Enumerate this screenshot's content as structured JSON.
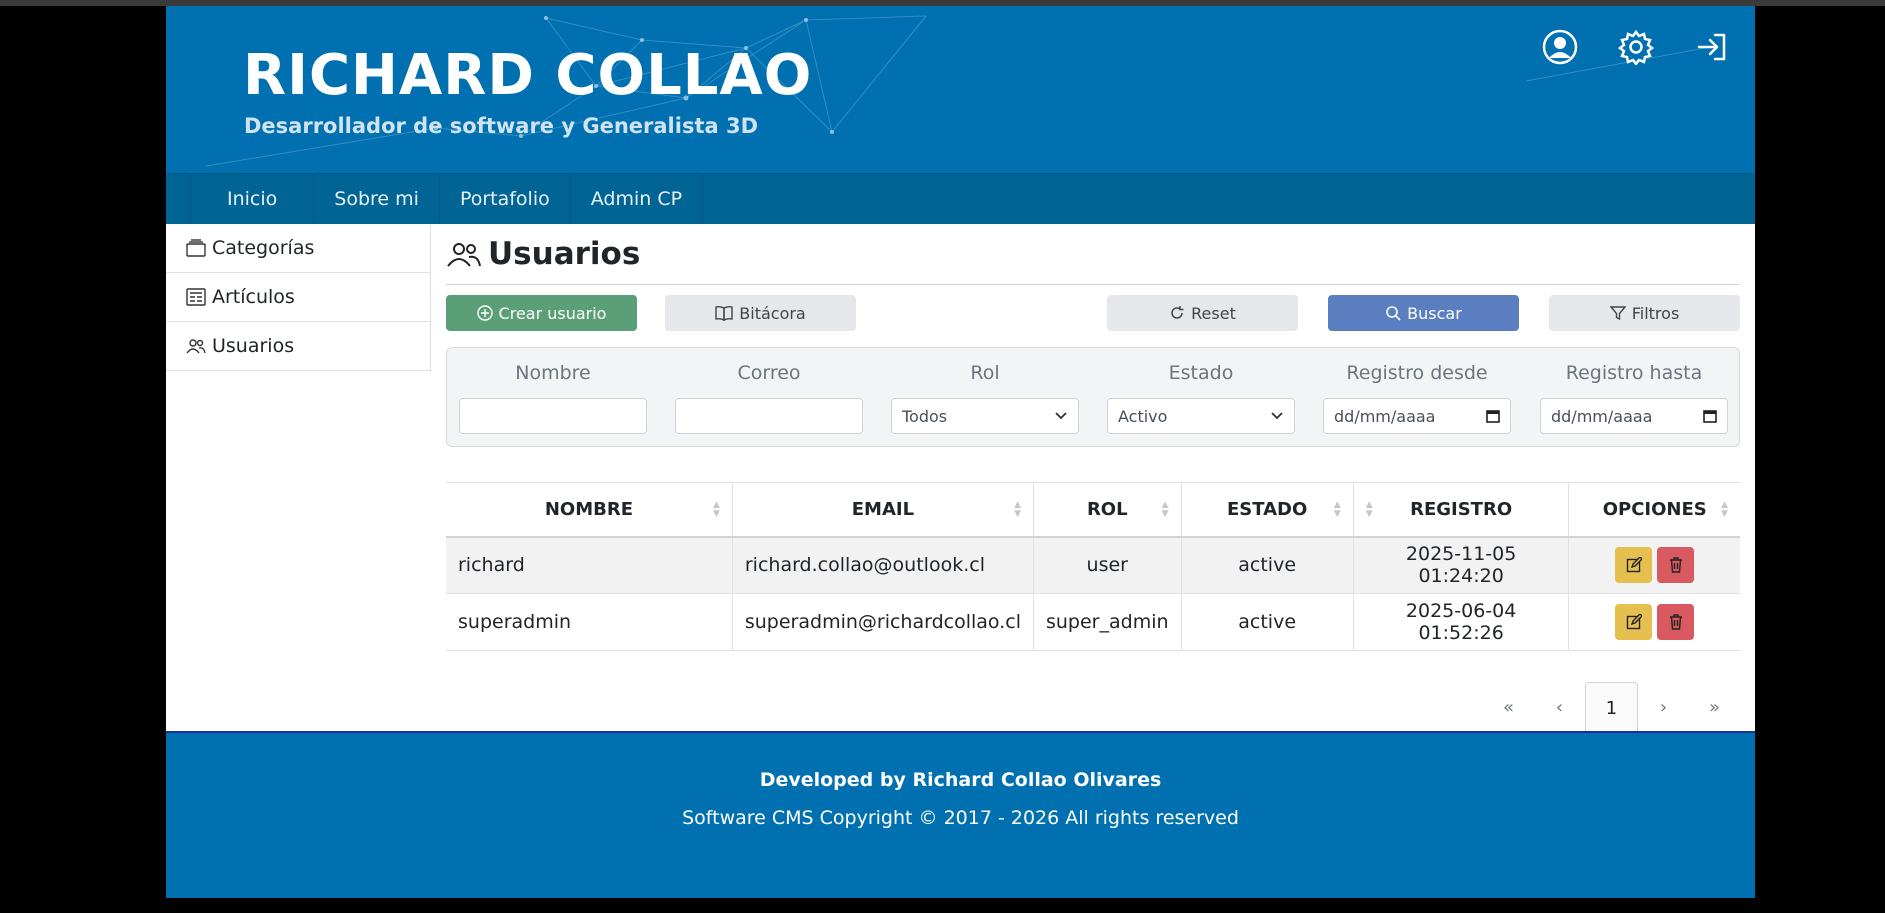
{
  "header": {
    "title": "RICHARD COLLAO",
    "subtitle": "Desarrollador de software y Generalista 3D",
    "icons": [
      "user-circle-icon",
      "gear-icon",
      "sign-in-icon"
    ]
  },
  "nav": {
    "items": [
      "Inicio",
      "Sobre mi",
      "Portafolio",
      "Admin CP"
    ]
  },
  "sidebar": {
    "items": [
      {
        "label": "Categorías",
        "icon": "folder-icon"
      },
      {
        "label": "Artículos",
        "icon": "newspaper-icon"
      },
      {
        "label": "Usuarios",
        "icon": "users-icon"
      }
    ]
  },
  "main": {
    "title": "Usuarios",
    "buttons": {
      "create": "Crear usuario",
      "log": "Bitácora",
      "reset": "Reset",
      "search": "Buscar",
      "filters": "Filtros"
    },
    "filters": {
      "name_label": "Nombre",
      "email_label": "Correo",
      "role_label": "Rol",
      "role_value": "Todos",
      "status_label": "Estado",
      "status_value": "Activo",
      "from_label": "Registro desde",
      "from_placeholder": "dd/mm/aaaa",
      "to_label": "Registro hasta",
      "to_placeholder": "dd/mm/aaaa"
    },
    "table": {
      "headers": [
        "NOMBRE",
        "EMAIL",
        "ROL",
        "ESTADO",
        "REGISTRO",
        "OPCIONES"
      ],
      "rows": [
        {
          "name": "richard",
          "email": "richard.collao@outlook.cl",
          "role": "user",
          "status": "active",
          "registered": "2025-11-05 01:24:20"
        },
        {
          "name": "superadmin",
          "email": "superadmin@richardcollao.cl",
          "role": "super_admin",
          "status": "active",
          "registered": "2025-06-04 01:52:26"
        }
      ]
    },
    "pagination": {
      "first": "«",
      "prev": "‹",
      "current": "1",
      "next": "›",
      "last": "»"
    }
  },
  "footer": {
    "line1_prefix": "Developed by",
    "line1_name": "Richard Collao Olivares",
    "line2": "Software CMS Copyright © 2017 - 2026 All rights reserved"
  },
  "colors": {
    "brand": "#0070b0",
    "nav": "#006494",
    "create": "#5b9f77",
    "search": "#5b7ec1",
    "edit": "#e5c04f",
    "delete": "#d85a60"
  }
}
